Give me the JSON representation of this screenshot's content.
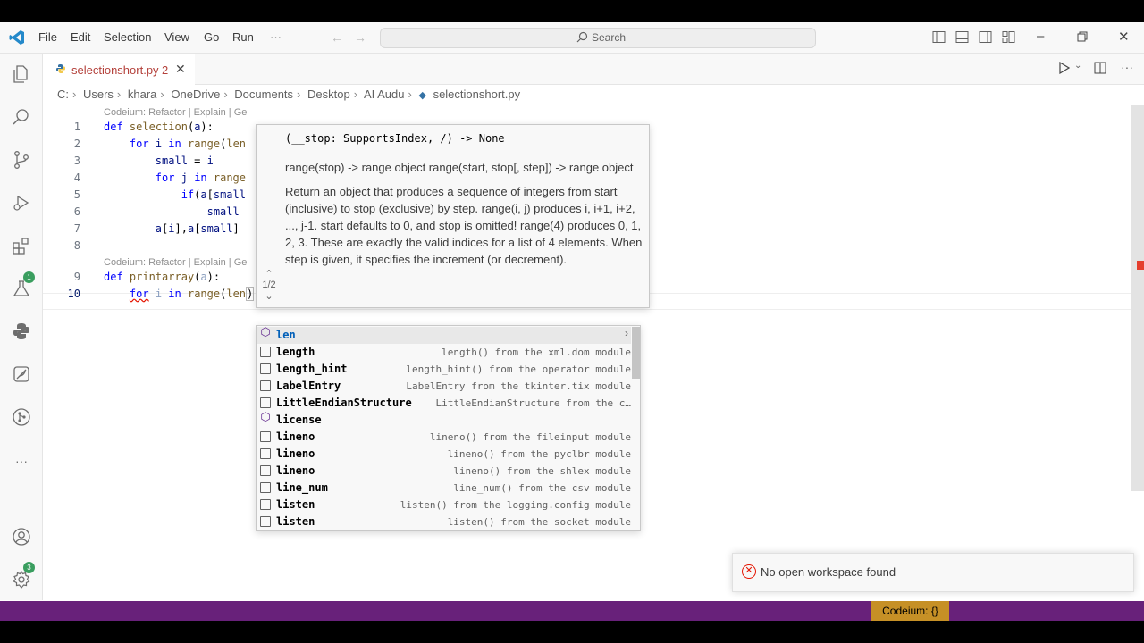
{
  "titlebar": {
    "menu": [
      "File",
      "Edit",
      "Selection",
      "View",
      "Go",
      "Run",
      "···"
    ],
    "search_label": "Search"
  },
  "tab": {
    "file_icon": "py",
    "label": "selectionshort.py",
    "problem_count": "2",
    "close": "✕"
  },
  "breadcrumb": [
    "C:",
    "Users",
    "khara",
    "OneDrive",
    "Documents",
    "Desktop",
    "AI Audu",
    "selectionshort.py"
  ],
  "editor": {
    "lens": "Codeium: Refactor | Explain | Ge",
    "line_numbers": [
      "1",
      "2",
      "3",
      "4",
      "5",
      "6",
      "7",
      "8",
      "9",
      "10"
    ]
  },
  "hover": {
    "signature": "(__stop: SupportsIndex, /) -> None",
    "summary": "range(stop) -> range object range(start, stop[, step]) -> range object",
    "description": "Return an object that produces a sequence of integers from start (inclusive) to stop (exclusive) by step. range(i, j) produces i, i+1, i+2, ..., j-1. start defaults to 0, and stop is omitted! range(4) produces 0, 1, 2, 3. These are exactly the valid indices for a list of 4 elements. When step is given, it specifies the increment (or decrement).",
    "overload_counter": "1/2"
  },
  "suggest": {
    "items": [
      {
        "label": "len",
        "detail": "",
        "kind": "module"
      },
      {
        "label": "length",
        "detail": "length() from the xml.dom module",
        "kind": "variable"
      },
      {
        "label": "length_hint",
        "detail": "length_hint() from the operator module",
        "kind": "variable"
      },
      {
        "label": "LabelEntry",
        "detail": "LabelEntry from the tkinter.tix module",
        "kind": "variable"
      },
      {
        "label": "LittleEndianStructure",
        "detail": "LittleEndianStructure from the c…",
        "kind": "variable"
      },
      {
        "label": "license",
        "detail": "",
        "kind": "module"
      },
      {
        "label": "lineno",
        "detail": "lineno() from the fileinput module",
        "kind": "variable"
      },
      {
        "label": "lineno",
        "detail": "lineno() from the pyclbr module",
        "kind": "variable"
      },
      {
        "label": "lineno",
        "detail": "lineno() from the shlex module",
        "kind": "variable"
      },
      {
        "label": "line_num",
        "detail": "line_num() from the csv module",
        "kind": "variable"
      },
      {
        "label": "listen",
        "detail": "listen() from the logging.config module",
        "kind": "variable"
      },
      {
        "label": "listen",
        "detail": "listen() from the socket module",
        "kind": "variable"
      }
    ]
  },
  "notification": {
    "message": "No open workspace found"
  },
  "statusbar": {
    "codeium": "Codeium: {}"
  },
  "badges": {
    "extensions": "1",
    "accounts": "3"
  },
  "colors": {
    "accent": "#005fb8",
    "statusbar": "#68217a",
    "codeium_status": "#c69026",
    "error": "#e51400"
  }
}
